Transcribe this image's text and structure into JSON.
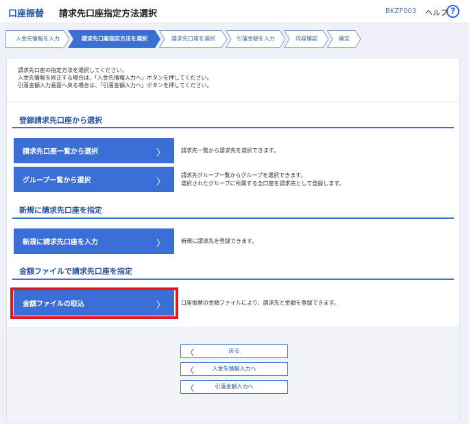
{
  "header": {
    "service": "口座振替",
    "title": "請求先口座指定方法選択",
    "screen_code": "BKZF003",
    "help_label": "ヘルプ",
    "help_icon_glyph": "?"
  },
  "steps": [
    {
      "label": "入金先情報を入力"
    },
    {
      "label": "請求先口座指定方法を選択"
    },
    {
      "label": "請求先口座を選択"
    },
    {
      "label": "引落金額を入力"
    },
    {
      "label": "内容確認"
    },
    {
      "label": "確定"
    }
  ],
  "intro": {
    "line1": "請求先口座の指定方法を選択してください。",
    "line2": "入金先情報を修正する場合は、「入金先情報入力へ」ボタンを押してください。",
    "line3": "引落金額入力画面へ戻る場合は、「引落金額入力へ」ボタンを押してください。"
  },
  "sections": {
    "registered": {
      "title": "登録請求先口座から選択",
      "btn_list": "請求先口座一覧から選択",
      "desc_list": "請求先一覧から請求先を選択できます。",
      "btn_group": "グループ一覧から選択",
      "desc_group_1": "請求先グループ一覧からグループを選択できます。",
      "desc_group_2": "選択されたグループに所属する全口座を請求先として登録します。"
    },
    "new": {
      "title": "新規に請求先口座を指定",
      "btn_new": "新規に請求先口座を入力",
      "desc_new": "新規に請求先を登録できます。"
    },
    "file": {
      "title": "金額ファイルで請求先口座を指定",
      "btn_file": "金額ファイルの取込",
      "desc_file": "口座振替の金額ファイルにより、請求先と金額を登録できます。"
    }
  },
  "chevron_glyph": "〉",
  "back_glyph": "〈",
  "bottom_buttons": {
    "back": "戻る",
    "to_payee": "入金先情報入力へ",
    "to_amount": "引落金額入力へ"
  },
  "colors": {
    "primary": "#3a6fd5",
    "highlight": "#e0191f",
    "active_step": "#3a6fd5"
  }
}
